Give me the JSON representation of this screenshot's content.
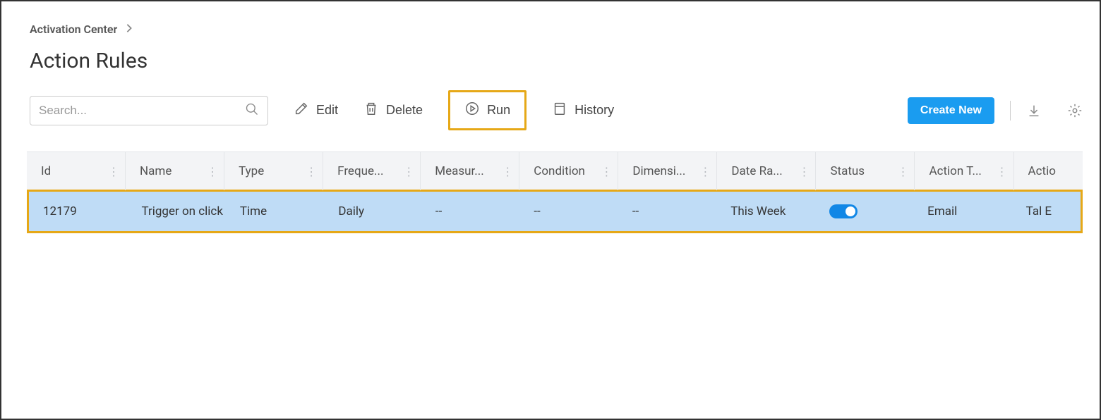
{
  "breadcrumb": {
    "item0": "Activation Center"
  },
  "page": {
    "title": "Action Rules"
  },
  "search": {
    "placeholder": "Search..."
  },
  "toolbar": {
    "edit_label": "Edit",
    "delete_label": "Delete",
    "run_label": "Run",
    "history_label": "History",
    "create_label": "Create New"
  },
  "table": {
    "columns": {
      "c0": "Id",
      "c1": "Name",
      "c2": "Type",
      "c3": "Freque...",
      "c4": "Measur...",
      "c5": "Condition",
      "c6": "Dimensi...",
      "c7": "Date Ra...",
      "c8": "Status",
      "c9": "Action T...",
      "c10": "Actio"
    },
    "rows": [
      {
        "id": "12179",
        "name": "Trigger on click",
        "type": "Time",
        "frequency": "Daily",
        "measure": "--",
        "condition": "--",
        "dimension": "--",
        "date_range": "This Week",
        "status_on": true,
        "action_type": "Email",
        "action": "Tal E"
      }
    ]
  }
}
